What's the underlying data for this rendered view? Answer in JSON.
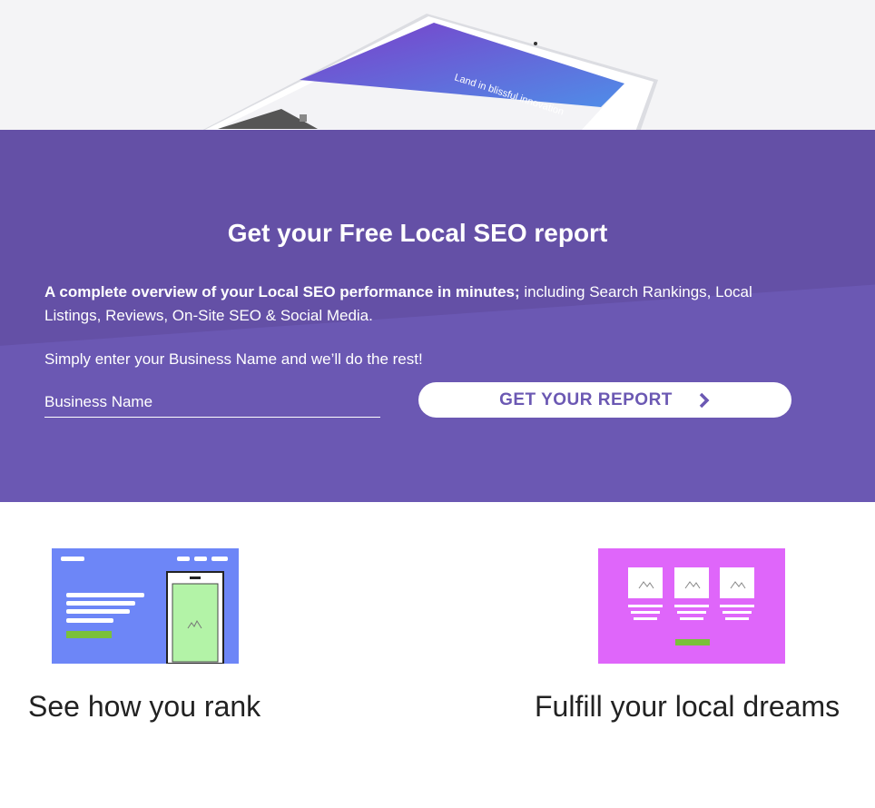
{
  "hero": {
    "tablet_headline": "Land in blissful innovation"
  },
  "seo": {
    "title": "Get your Free Local SEO report",
    "desc_bold": "A complete overview of your Local SEO performance in minutes;",
    "desc_rest": " including Search Rankings, Local Listings, Reviews, On-Site SEO & Social Media.",
    "hint": "Simply enter your Business Name and we’ll do the rest!",
    "input_placeholder": "Business Name",
    "cta_label": "GET YOUR REPORT",
    "cta_icon": "chevron-right-icon",
    "bg_color": "#6b58b3"
  },
  "features": [
    {
      "title": "See how you rank",
      "icon": "website-mockup-illustration",
      "color": "#6d86f7"
    },
    {
      "title": "Fulfill your local dreams",
      "icon": "gallery-mockup-illustration",
      "color": "#df66fa"
    }
  ]
}
